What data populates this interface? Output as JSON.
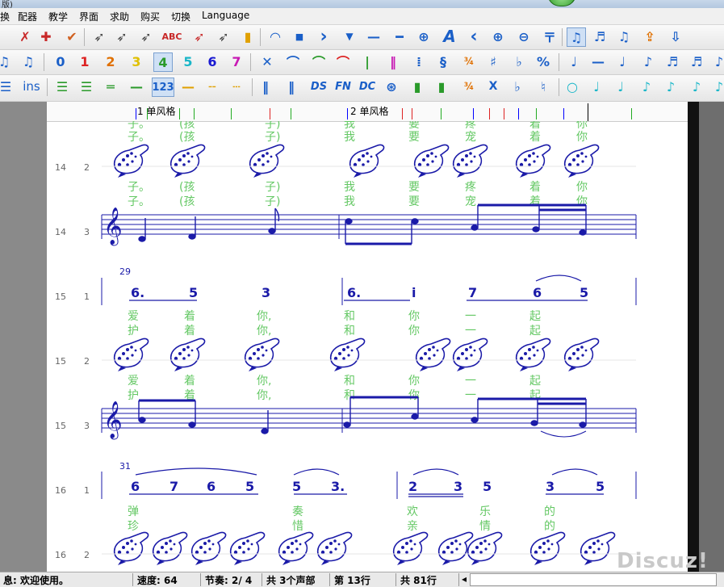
{
  "window": {
    "title_fragment": "版)"
  },
  "menu": [
    "换",
    "配器",
    "教学",
    "界面",
    "求助",
    "购买",
    "切换",
    "Language"
  ],
  "toolbar3": {
    "ins_label": "ins",
    "ds": "DS",
    "fn": "FN",
    "dc": "DC",
    "num_label": "123",
    "x_label": "X"
  },
  "ruler": {
    "label1": "1 单风格",
    "label2": "2 单风格"
  },
  "score": {
    "measure_numbers": [
      "29",
      "31"
    ],
    "rows": [
      {
        "line": "14",
        "voice": "2",
        "lyric1": [
          "子。",
          "(孩",
          "子)",
          "我",
          "要",
          "疼",
          "着",
          "你"
        ],
        "lyric2": [
          "子。",
          "(孩",
          "子)",
          "我",
          "要",
          "宠",
          "着",
          "你"
        ]
      },
      {
        "line": "14",
        "voice": "3",
        "lyric1": [
          "子。",
          "(孩",
          "子)",
          "我",
          "要",
          "疼",
          "着",
          "你"
        ],
        "lyric2": [
          "子。",
          "(孩",
          "子)",
          "我",
          "要",
          "宠",
          "着",
          "你"
        ]
      },
      {
        "line": "15",
        "voice": "1",
        "numbers": [
          "6.",
          "5",
          "3",
          "6.",
          "i",
          "7",
          "6",
          "5"
        ],
        "lyric1": [
          "爱",
          "着",
          "你,",
          "和",
          "你",
          "一",
          "起"
        ],
        "lyric2": [
          "护",
          "着",
          "你,",
          "和",
          "你",
          "一",
          "起"
        ]
      },
      {
        "line": "15",
        "voice": "2"
      },
      {
        "line": "15",
        "voice": "3"
      },
      {
        "line": "16",
        "voice": "1",
        "numbers": [
          "6",
          "7",
          "6",
          "5",
          "5",
          "3.",
          "2",
          "3",
          "5",
          "3",
          "5"
        ],
        "lyric1": [
          "弹",
          "奏",
          "欢",
          "乐",
          "的"
        ],
        "lyric2": [
          "珍",
          "惜",
          "亲",
          "情",
          "的"
        ]
      },
      {
        "line": "16",
        "voice": "2"
      }
    ]
  },
  "status": {
    "message": "息: 欢迎使用。",
    "tempo": "速度: 64",
    "meter": "节奏: 2/ 4",
    "voices": "共 3个声部",
    "current_line": "第 13行",
    "total_lines": "共 81行"
  },
  "watermark": "Discuz!",
  "colors": {
    "note_blue": "#1a1aa8",
    "lyric_green": "#64c864",
    "toolbar_number_colors": [
      "#1a5fc8",
      "#d22",
      "#e07000",
      "#e0c000",
      "#2a9a2a",
      "#1ab6c8",
      "#1a1ad2",
      "#c81ab4"
    ]
  }
}
